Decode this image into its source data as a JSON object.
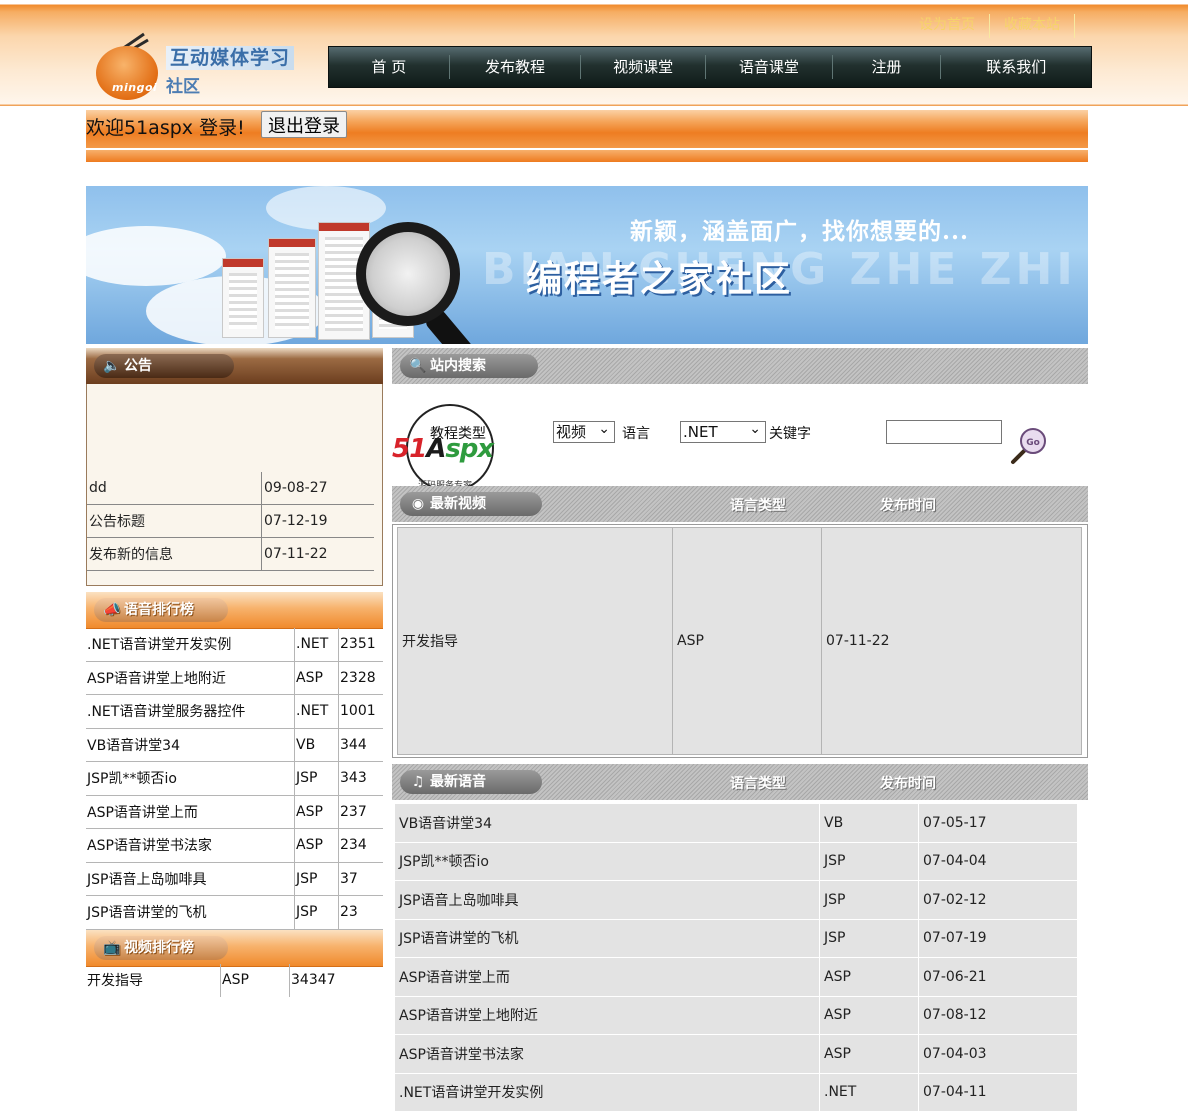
{
  "header": {
    "top_links": [
      "设为首页",
      "收藏本站"
    ],
    "logo": {
      "title": "互动媒体学习",
      "subtitle": "社区",
      "brand": "mingoi"
    },
    "nav": [
      "首 页",
      "发布教程",
      "视频课堂",
      "语音课堂",
      "注册",
      "联系我们"
    ]
  },
  "welcome": {
    "text": "欢迎51aspx  登录!",
    "logout_label": "退出登录"
  },
  "banner": {
    "slogan": "新颖，涵盖面广，找你想要的...",
    "title": "编程者之家社区",
    "ghost": "BIAN CHENG ZHE ZHI JIA"
  },
  "notice": {
    "title": "公告",
    "items": [
      {
        "title": "dd",
        "date": "09-08-27"
      },
      {
        "title": "公告标题",
        "date": "07-12-19"
      },
      {
        "title": "发布新的信息",
        "date": "07-11-22"
      }
    ]
  },
  "audio_rank": {
    "title": "语音排行榜",
    "items": [
      {
        "name": ".NET语音讲堂开发实例",
        "lang": ".NET",
        "count": "2351"
      },
      {
        "name": "ASP语音讲堂上地附近",
        "lang": "ASP",
        "count": "2328"
      },
      {
        "name": ".NET语音讲堂服务器控件",
        "lang": ".NET",
        "count": "1001"
      },
      {
        "name": "VB语音讲堂34",
        "lang": "VB",
        "count": "344"
      },
      {
        "name": "JSP凯**顿否io",
        "lang": "JSP",
        "count": "343"
      },
      {
        "name": "ASP语音讲堂上而",
        "lang": "ASP",
        "count": "237"
      },
      {
        "name": "ASP语音讲堂书法家",
        "lang": "ASP",
        "count": "234"
      },
      {
        "name": "JSP语音上岛咖啡具",
        "lang": "JSP",
        "count": "37"
      },
      {
        "name": "JSP语音讲堂的飞机",
        "lang": "JSP",
        "count": "23"
      }
    ]
  },
  "video_rank": {
    "title": "视频排行榜",
    "items": [
      {
        "name": "开发指导",
        "lang": "ASP",
        "count": "34347"
      }
    ]
  },
  "search": {
    "title": "站内搜索",
    "type_label": "教程类型",
    "type_value": "视频",
    "lang_label": "语言",
    "lang_value": ".NET",
    "keyword_label": "关键字",
    "keyword_value": "",
    "watermark": {
      "brand_51": "51",
      "brand_a": "A",
      "brand_spx": "spx",
      "sub": "源码服务专家"
    }
  },
  "latest_video": {
    "title": "最新视频",
    "col_lang": "语言类型",
    "col_time": "发布时间",
    "items": [
      {
        "name": "开发指导",
        "lang": "ASP",
        "date": "07-11-22"
      }
    ]
  },
  "latest_audio": {
    "title": "最新语音",
    "col_lang": "语言类型",
    "col_time": "发布时间",
    "items": [
      {
        "name": "VB语音讲堂34",
        "lang": "VB",
        "date": "07-05-17"
      },
      {
        "name": "JSP凯**顿否io",
        "lang": "JSP",
        "date": "07-04-04"
      },
      {
        "name": "JSP语音上岛咖啡具",
        "lang": "JSP",
        "date": "07-02-12"
      },
      {
        "name": "JSP语音讲堂的飞机",
        "lang": "JSP",
        "date": "07-07-19"
      },
      {
        "name": "ASP语音讲堂上而",
        "lang": "ASP",
        "date": "07-06-21"
      },
      {
        "name": "ASP语音讲堂上地附近",
        "lang": "ASP",
        "date": "07-08-12"
      },
      {
        "name": "ASP语音讲堂书法家",
        "lang": "ASP",
        "date": "07-04-03"
      },
      {
        "name": ".NET语音讲堂开发实例",
        "lang": ".NET",
        "date": "07-04-11"
      }
    ]
  },
  "colors": {
    "accent_orange": "#ee7d22",
    "nav_dark": "#0f1a18",
    "notice_brown": "#6b3d1e",
    "cell_gray": "#e3e3e3"
  }
}
